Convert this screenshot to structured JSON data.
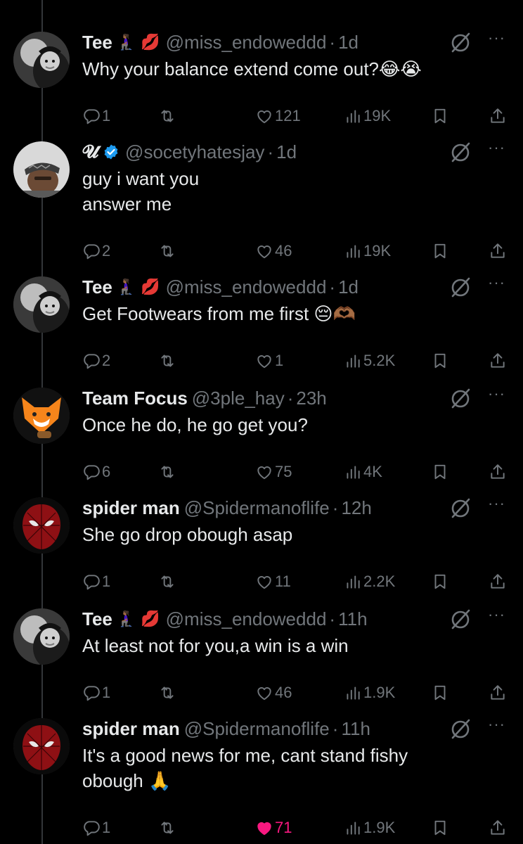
{
  "colors": {
    "background": "#000000",
    "text": "#e7e9ea",
    "muted": "#71767b",
    "like_active": "#f91880",
    "verified": "#1d9bf0"
  },
  "tweets": [
    {
      "name": "Tee",
      "emojis": "🧎🏾‍♀️ 💋",
      "verified": false,
      "handle": "@miss_endoweddd",
      "time": "1d",
      "lines": [
        "Why your balance extend come out?😂😭"
      ],
      "replies": "1",
      "retweets": "",
      "likes": "121",
      "liked": false,
      "views": "19K",
      "avatar": "tee"
    },
    {
      "name": "𝓤",
      "emojis": "",
      "verified": true,
      "handle": "@socetyhatesjay",
      "time": "1d",
      "lines": [
        "guy i want you",
        "answer me"
      ],
      "replies": "2",
      "retweets": "",
      "likes": "46",
      "liked": false,
      "views": "19K",
      "avatar": "jay"
    },
    {
      "name": "Tee",
      "emojis": "🧎🏾‍♀️ 💋",
      "verified": false,
      "handle": "@miss_endoweddd",
      "time": "1d",
      "lines": [
        "Get Footwears from me first 😔🫶🏾"
      ],
      "replies": "2",
      "retweets": "",
      "likes": "1",
      "liked": false,
      "views": "5.2K",
      "avatar": "tee"
    },
    {
      "name": "Team Focus",
      "emojis": "",
      "verified": false,
      "handle": "@3ple_hay",
      "time": "23h",
      "lines": [
        "Once he do, he go get you?"
      ],
      "replies": "6",
      "retweets": "",
      "likes": "75",
      "liked": false,
      "views": "4K",
      "avatar": "fox"
    },
    {
      "name": "spider man",
      "emojis": "",
      "verified": false,
      "handle": "@Spidermanoflife",
      "time": "12h",
      "lines": [
        "She go drop obough asap"
      ],
      "replies": "1",
      "retweets": "",
      "likes": "11",
      "liked": false,
      "views": "2.2K",
      "avatar": "spider"
    },
    {
      "name": "Tee",
      "emojis": "🧎🏾‍♀️ 💋",
      "verified": false,
      "handle": "@miss_endoweddd",
      "time": "11h",
      "lines": [
        "At least not for you,a win is a win"
      ],
      "replies": "1",
      "retweets": "",
      "likes": "46",
      "liked": false,
      "views": "1.9K",
      "avatar": "tee"
    },
    {
      "name": "spider man",
      "emojis": "",
      "verified": false,
      "handle": "@Spidermanoflife",
      "time": "11h",
      "lines": [
        "It's a good news for me, cant stand fishy",
        "obough 🙏"
      ],
      "replies": "1",
      "retweets": "",
      "likes": "71",
      "liked": true,
      "views": "1.9K",
      "avatar": "spider"
    }
  ]
}
